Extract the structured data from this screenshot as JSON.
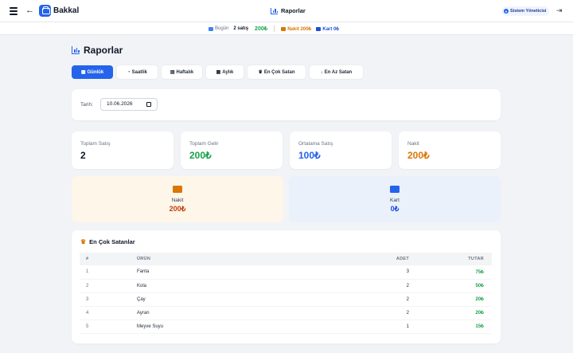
{
  "app": {
    "title": "Bakkal"
  },
  "header": {
    "page_title": "Raporlar",
    "user_label": "Sistem Yöneticisi"
  },
  "status_bar": {
    "today_label": "Bugün",
    "sales_count": "2 satış",
    "total": "200₺",
    "cash": "Nakit 200₺",
    "card": "Kart 0₺"
  },
  "page": {
    "title": "Raporlar"
  },
  "tabs": [
    {
      "label": "Günlük",
      "icon": "calendar-day-icon",
      "active": true
    },
    {
      "label": "Saatlik",
      "icon": "clock-icon"
    },
    {
      "label": "Haftalık",
      "icon": "calendar-week-icon"
    },
    {
      "label": "Aylık",
      "icon": "calendar-month-icon"
    },
    {
      "label": "En Çok Satan",
      "icon": "trophy-icon"
    },
    {
      "label": "En Az Satan",
      "icon": "arrow-down-icon"
    }
  ],
  "date_filter": {
    "label": "Tarih:",
    "value": "10.06.2026"
  },
  "stats": [
    {
      "label": "Toplam Satış",
      "value": "2",
      "color": "#111827"
    },
    {
      "label": "Toplam Gelir",
      "value": "200₺",
      "color": "#16a34a"
    },
    {
      "label": "Ortalama Satış",
      "value": "100₺",
      "color": "#2563eb"
    },
    {
      "label": "Nakit",
      "value": "200₺",
      "color": "#d97706"
    }
  ],
  "payments": {
    "cash": {
      "label": "Nakit",
      "value": "200₺",
      "color": "#c2410c",
      "bg": "#fdf6e9"
    },
    "card": {
      "label": "Kart",
      "value": "0₺",
      "color": "#1d4ed8",
      "bg": "#eaf1fb"
    }
  },
  "top_sellers": {
    "title": "En Çok Satanlar",
    "columns": [
      "#",
      "ÜRÜN",
      "ADET",
      "TUTAR"
    ],
    "rows": [
      {
        "idx": "1",
        "name": "Fanta",
        "qty": "3",
        "total": "75₺"
      },
      {
        "idx": "2",
        "name": "Kola",
        "qty": "2",
        "total": "50₺"
      },
      {
        "idx": "3",
        "name": "Çay",
        "qty": "2",
        "total": "20₺"
      },
      {
        "idx": "4",
        "name": "Ayran",
        "qty": "2",
        "total": "20₺"
      },
      {
        "idx": "5",
        "name": "Meyve Suyu",
        "qty": "1",
        "total": "15₺"
      }
    ]
  }
}
